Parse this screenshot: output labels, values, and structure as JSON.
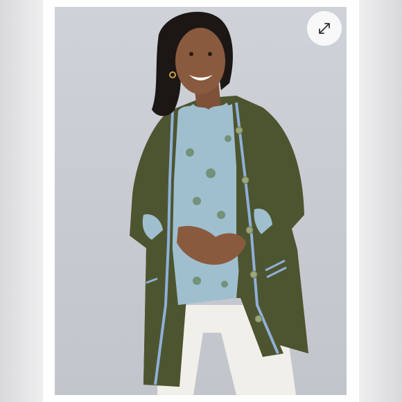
{
  "viewer": {
    "expand_icon": "expand-diagonal-arrows-icon"
  },
  "colors": {
    "backdrop": "#c8cbd2",
    "cardigan": "#4d5530",
    "cardigan_trim": "#8fb0d8",
    "blouse": "#9fbfcf",
    "pants": "#f1efe9",
    "button_bg": "#ffffff"
  }
}
